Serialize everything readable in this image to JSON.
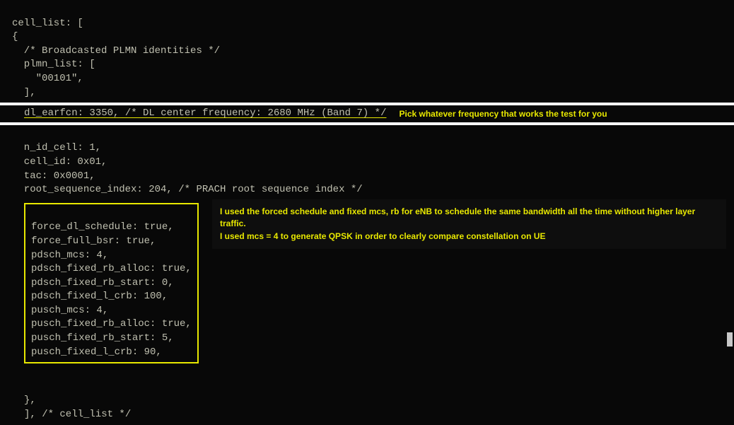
{
  "section1": {
    "l1": "cell_list: [",
    "l2": "{",
    "l3": "  /* Broadcasted PLMN identities */",
    "l4": "  plmn_list: [",
    "l5": "    \"00101\",",
    "l6": "  ],"
  },
  "earfcn": {
    "code": "dl_earfcn: 3350,  /* DL center frequency: 2680 MHz (Band 7) */",
    "note": "Pick whatever frequency that works the test for you"
  },
  "section2a": {
    "l1": "  n_id_cell: 1,",
    "l2": "  cell_id: 0x01,",
    "l3": "  tac: 0x0001,",
    "l4": "  root_sequence_index: 204, /* PRACH root sequence index */"
  },
  "box": {
    "l1": "force_dl_schedule: true,",
    "l2": "force_full_bsr: true,",
    "l3": "pdsch_mcs: 4,",
    "l4": "pdsch_fixed_rb_alloc: true,",
    "l5": "pdsch_fixed_rb_start: 0,",
    "l6": "pdsch_fixed_l_crb: 100,",
    "l7": "pusch_mcs: 4,",
    "l8": "pusch_fixed_rb_alloc: true,",
    "l9": "pusch_fixed_rb_start: 5,",
    "l10": "pusch_fixed_l_crb: 90,"
  },
  "annotation": {
    "line1": "I used the forced schedule and fixed mcs, rb for eNB to schedule the same bandwidth all the time without higher layer traffic.",
    "line2": "I used mcs = 4 to generate QPSK in order to clearly compare constellation on UE"
  },
  "bottom": {
    "l1": "},",
    "l2": "], /* cell_list */"
  }
}
